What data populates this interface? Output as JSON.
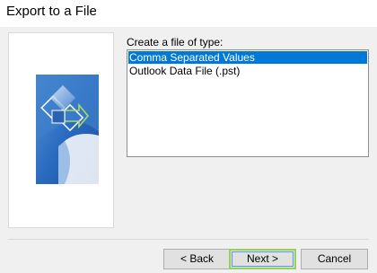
{
  "window": {
    "title": "Export to a File"
  },
  "dialog": {
    "prompt": "Create a file of type:",
    "file_types": [
      {
        "label": "Comma Separated Values",
        "selected": true
      },
      {
        "label": "Outlook Data File (.pst)",
        "selected": false
      }
    ]
  },
  "buttons": {
    "back": "< Back",
    "next": "Next >",
    "cancel": "Cancel"
  },
  "colors": {
    "selection": "#0078d7",
    "graphic_blue": "#1f5fb0",
    "default_button_border": "#9ad05a"
  },
  "icons": {
    "wizard_graphic": "export-wizard-graphic"
  }
}
